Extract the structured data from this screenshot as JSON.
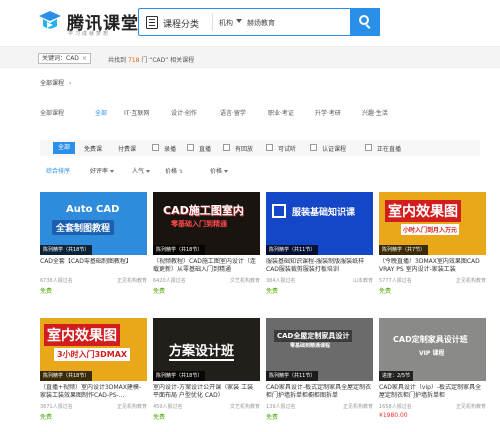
{
  "brand": {
    "title": "腾讯课堂",
    "subtitle": "学习成就梦想"
  },
  "search": {
    "category_label": "课程分类",
    "scope": "机构",
    "query": "赫炀教育"
  },
  "keyword_bar": {
    "tag": "关键词：CAD",
    "tag_close": "×",
    "result_prefix": "共找到",
    "result_count": "718",
    "result_suffix": "门 “CAD” 相关课程"
  },
  "breadcrumb": {
    "label": "全部课程",
    "chevron": "›"
  },
  "category_nav": [
    "全部课程",
    "全部",
    "IT·互联网",
    "设计·创作",
    "语言·留学",
    "职业·考证",
    "升学·考研",
    "兴趣·生活"
  ],
  "filters": {
    "all": "全部",
    "free": "免费课",
    "paid": "付费课",
    "checkbox_items": [
      "录播",
      "直播",
      "有回放",
      "可试听",
      "认证课程",
      "正在直播"
    ]
  },
  "sort": {
    "items": [
      "综合排序",
      "好评率",
      "人气",
      "价格",
      "价格"
    ],
    "arrow": "⇅"
  },
  "courses": [
    {
      "thumb_bg": "#2f8bdc",
      "big_text": "Auto CAD",
      "big_text2": "全套制图教程",
      "badge": "陈列精学（共18节）",
      "title": "CAD全套【CAD零基础制图教程】",
      "students": "6736人报过名",
      "school": "正见机构教育",
      "price": "免费",
      "paid": false
    },
    {
      "thumb_bg": "#1a1410",
      "big_text": "CAD施工图室内",
      "big_text2": "零基础入门到精通",
      "badge": "陈列精学（共18节）",
      "title": "（视频教程）CAD施工图室内设计（连载更新）从零基础入门到精通",
      "students": "6420人报过名",
      "school": "文艺机构教育",
      "price": "免费",
      "paid": false
    },
    {
      "thumb_bg": "#1446c8",
      "big_text": "服装基础知识课",
      "big_text2": "",
      "badge": "陈列精学（共11节）",
      "title": "服装基础知识课程-服装制版服装纸样CAD服装裁剪服装打板培训",
      "students": "384人报过名",
      "school": "山本教育",
      "price": "免费",
      "paid": false
    },
    {
      "thumb_bg": "#e8a81a",
      "big_text": "室内效果图",
      "big_text2": "小时入门到月入万元",
      "badge": "陈列精学（共7节）",
      "title": "（今晚直播）3DMAX室内效果图CAD VRAY PS 室内设计-家装工装",
      "students": "5777人报过名",
      "school": "正见机构教育",
      "price": "免费",
      "paid": false
    },
    {
      "thumb_bg": "#e8a81a",
      "big_text": "室内效果图",
      "big_text2": "3小时入门3DMAX",
      "badge": "陈列精学（共18节）",
      "title": "（直播+视频）室内设计3DMAX建模-家装工装效果图制作CAD-PS-...",
      "students": "3671人报过名",
      "school": "正见机构教育",
      "price": "免费",
      "paid": false
    },
    {
      "thumb_bg": "#221e1a",
      "big_text": "方案设计班",
      "big_text2": "",
      "badge": "陈列精学（共18节）",
      "title": "室内设计-方案设计公开课（家装 工装 平面布局 户型优化 CAD）",
      "students": "459人报过名",
      "school": "文艺机构教育",
      "price": "免费",
      "paid": false
    },
    {
      "thumb_bg": "#6b6b6b",
      "big_text": "CAD全屋定制家具设计",
      "big_text2": "零基础到精通课程",
      "badge": "陈列精学（共11节）",
      "title": "CAD家具设计-板式定制家具全屋定制衣柜门护墙拆单柜橱柜图拆单",
      "students": "139人报过名",
      "school": "正见机构教育",
      "price": "免费",
      "paid": false
    },
    {
      "thumb_bg": "#8a8a88",
      "big_text": "CAD定制家具设计班",
      "big_text2": "VIP 课程",
      "badge": "进度：2/5节",
      "title": "CAD家具设计（vip）-板式定制家具全屋定制衣柜门护墙拆单柜",
      "students": "1658人报过名",
      "school": "正见机构教育",
      "price": "¥1980.00",
      "paid": true
    }
  ]
}
